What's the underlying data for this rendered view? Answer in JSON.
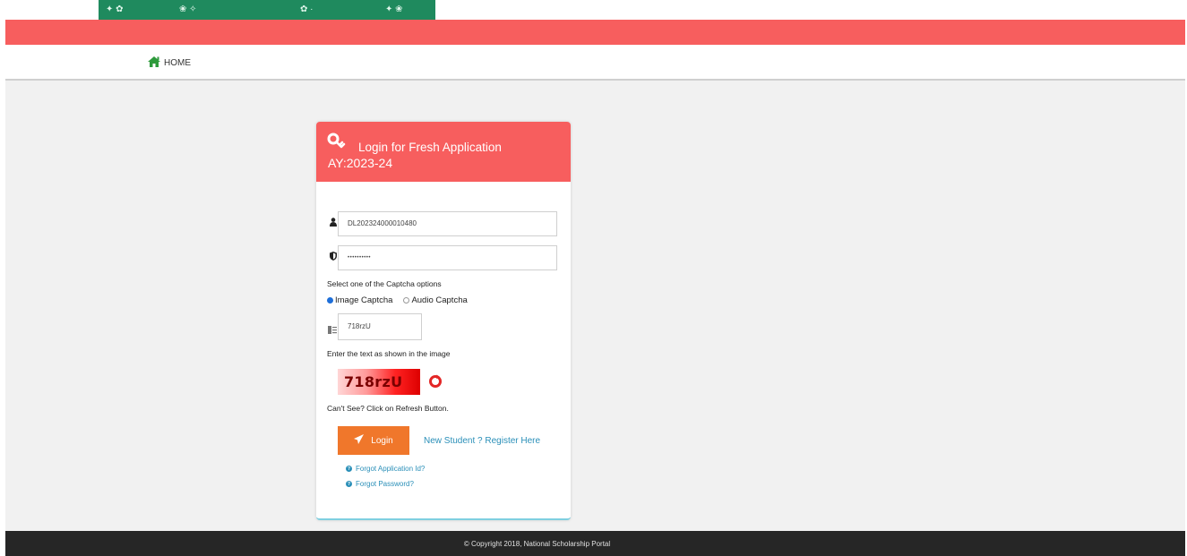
{
  "nav": {
    "home_label": "HOME"
  },
  "login_card": {
    "title": "Login for Fresh Application",
    "academic_year": "AY:2023-24",
    "application_id_value": "DL202324000010480",
    "password_value": "••••••••••",
    "captcha_prompt": "Select one of the Captcha options",
    "captcha_options": [
      {
        "label": "Image Captcha",
        "selected": true
      },
      {
        "label": "Audio Captcha",
        "selected": false
      }
    ],
    "captcha_input_value": "718rzU",
    "enter_text_label": "Enter the text as shown in the image",
    "captcha_image_text": "718rzU",
    "cant_see_text": "Can't See? Click on Refresh Button.",
    "login_button_label": "Login",
    "register_link_label": "New Student ? Register Here",
    "forgot_application_id_label": "Forgot Application Id?",
    "forgot_password_label": "Forgot Password?"
  },
  "footer": {
    "copyright": "© Copyright 2018, National Scholarship Portal"
  },
  "colors": {
    "header_red": "#f75e5e",
    "login_orange": "#f0772b",
    "link_blue": "#2a8fb8",
    "footer_dark": "#262626",
    "home_green": "#2e9a3c"
  }
}
